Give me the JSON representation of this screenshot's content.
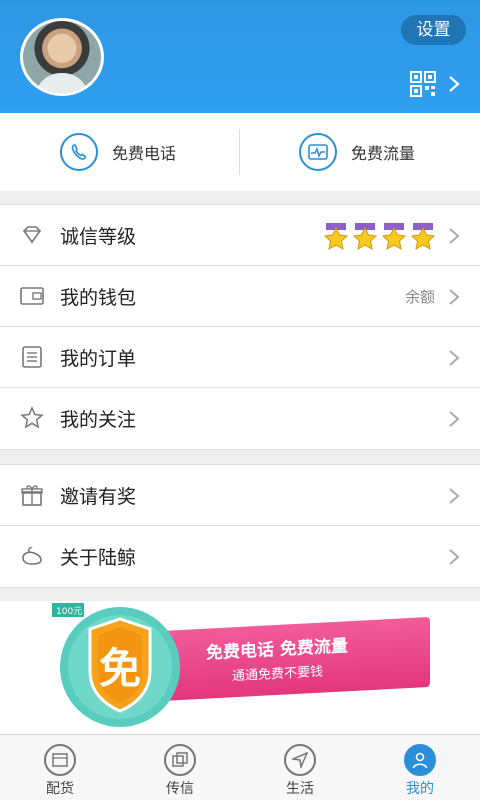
{
  "header": {
    "settings_label": "设置"
  },
  "quick_actions": [
    {
      "label": "免费电话",
      "icon": "phone-icon"
    },
    {
      "label": "免费流量",
      "icon": "data-traffic-icon"
    }
  ],
  "menu_group_1": [
    {
      "label": "诚信等级",
      "icon": "diamond-icon",
      "rating": 4,
      "rating_max": 4
    },
    {
      "label": "我的钱包",
      "icon": "wallet-icon",
      "hint": "余额"
    },
    {
      "label": "我的订单",
      "icon": "order-list-icon"
    },
    {
      "label": "我的关注",
      "icon": "star-outline-icon"
    }
  ],
  "menu_group_2": [
    {
      "label": "邀请有奖",
      "icon": "gift-icon"
    },
    {
      "label": "关于陆鲸",
      "icon": "whale-icon"
    }
  ],
  "banner": {
    "badge_char": "免",
    "corner_tag": "100元",
    "headline": "免费电话 免费流量",
    "subline": "通通免费不要钱"
  },
  "tabs": [
    {
      "label": "配货",
      "icon": "cargo-icon",
      "active": false
    },
    {
      "label": "传信",
      "icon": "message-icon",
      "active": false
    },
    {
      "label": "生活",
      "icon": "navigation-icon",
      "active": false
    },
    {
      "label": "我的",
      "icon": "person-icon",
      "active": true
    }
  ],
  "colors": {
    "accent": "#2b8fd8",
    "header": "#2f9ff0",
    "banner_pink": "#e2367d",
    "badge_orange": "#f7a21b"
  }
}
